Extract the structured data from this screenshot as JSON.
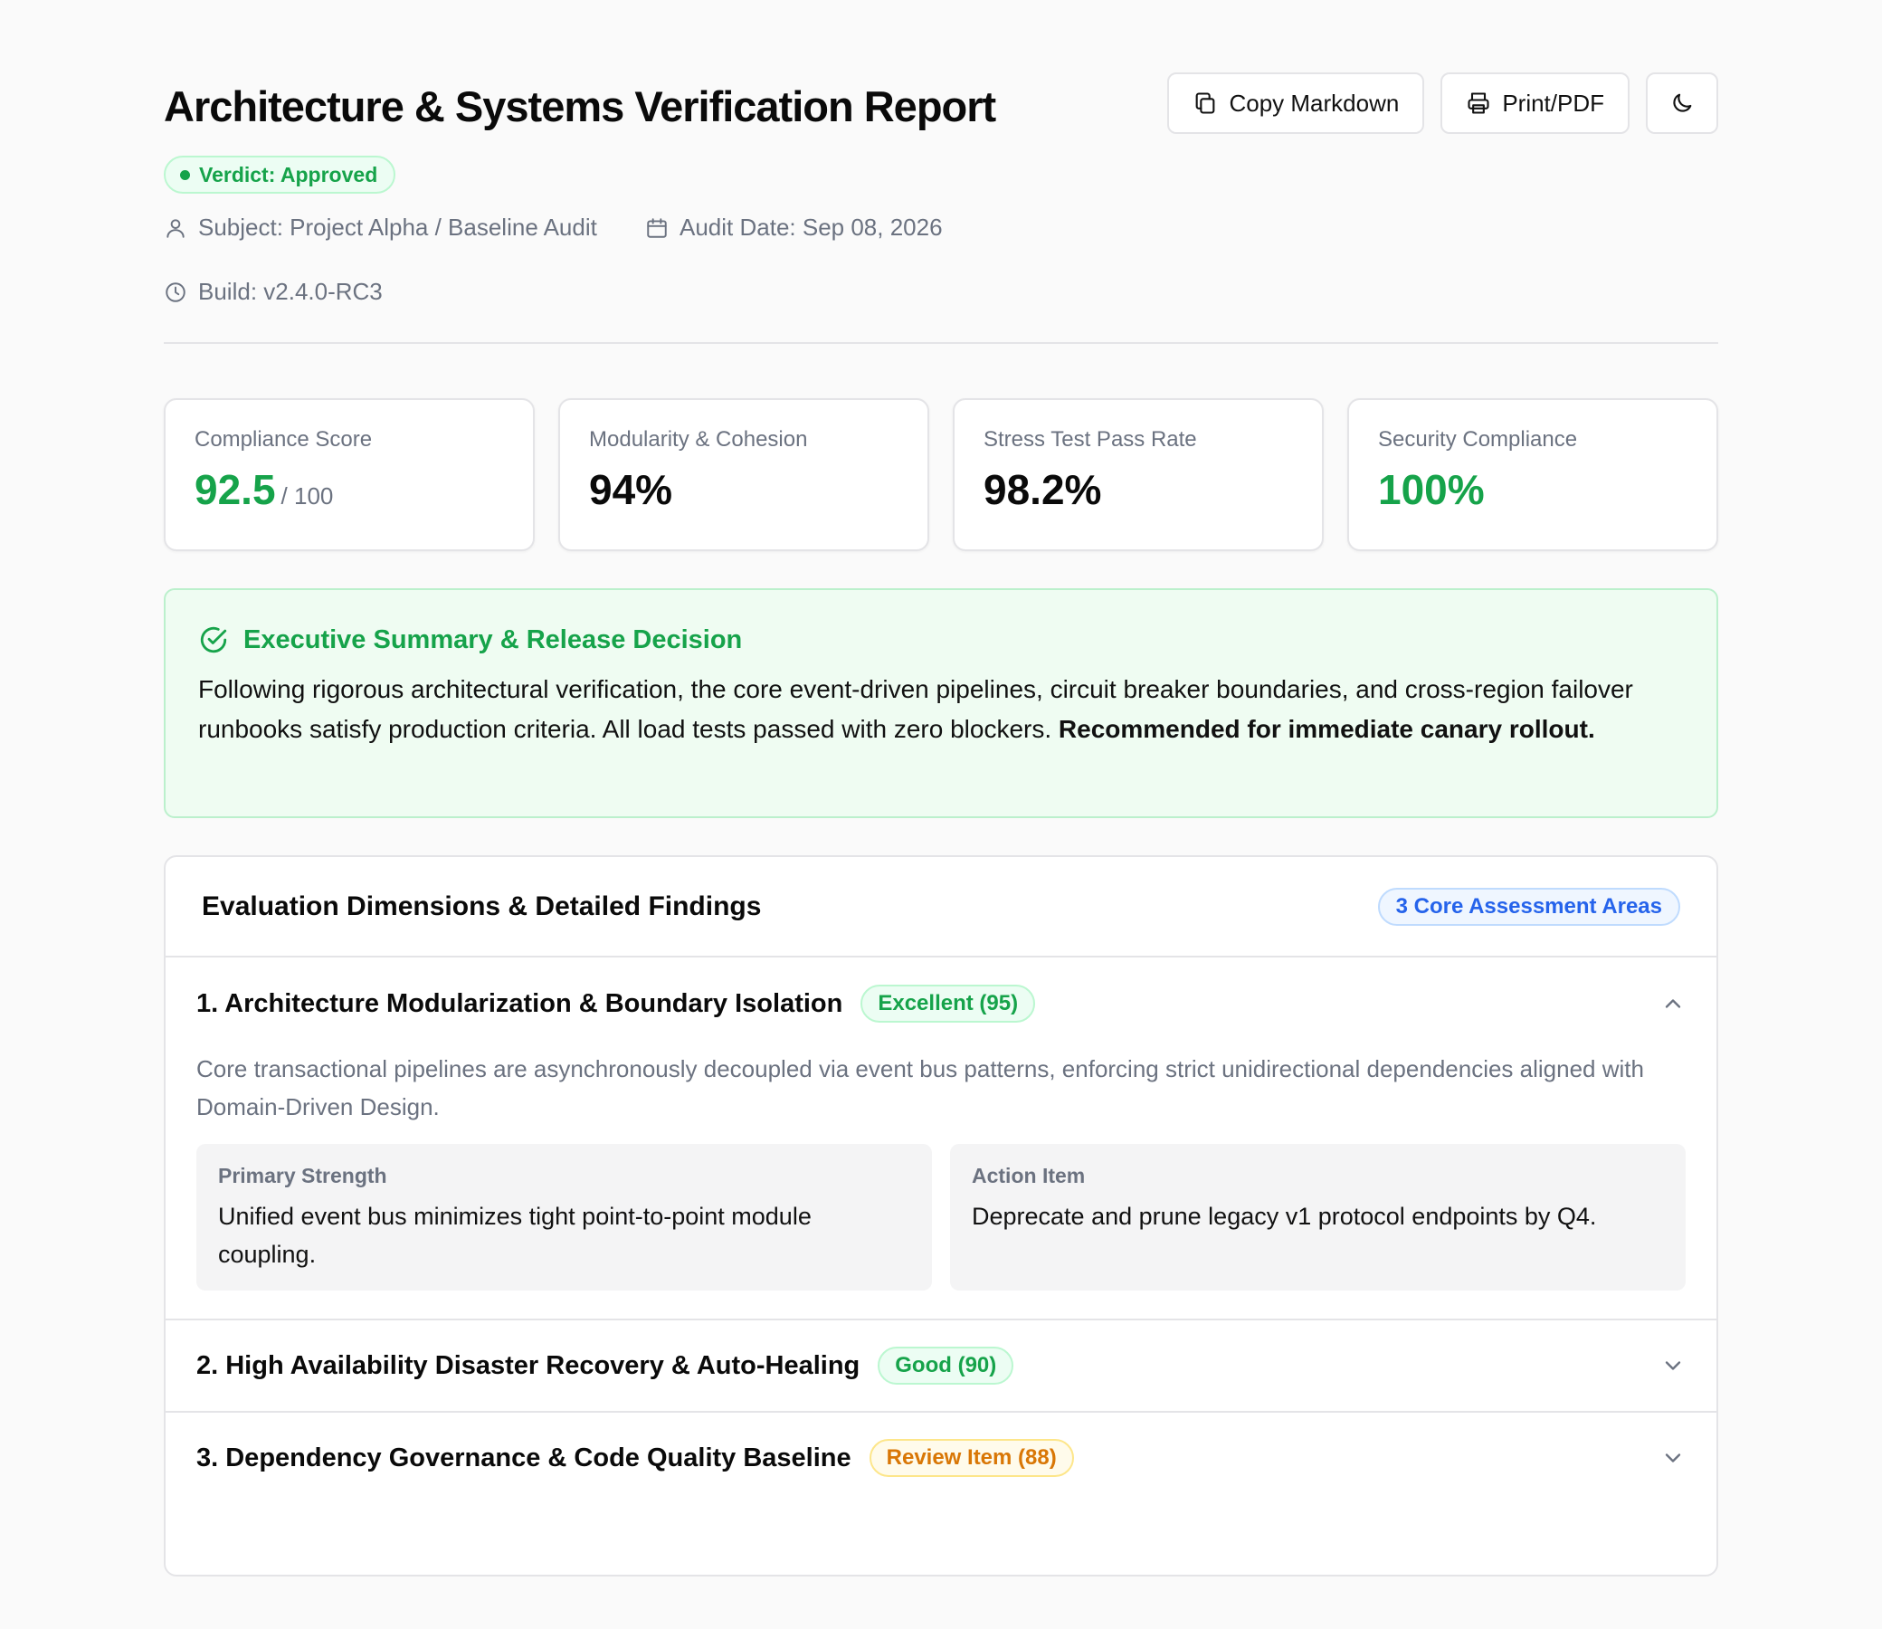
{
  "header": {
    "title": "Architecture & Systems Verification Report",
    "verdict": "Verdict: Approved",
    "subject": "Subject: Project Alpha / Baseline Audit",
    "audit_date": "Audit Date: Sep 08, 2026",
    "build": "Build: v2.4.0-RC3"
  },
  "actions": {
    "copy_markdown": "Copy Markdown",
    "print_pdf": "Print/PDF",
    "theme_icon": "moon-icon"
  },
  "stats": [
    {
      "label": "Compliance Score",
      "value": "92.5",
      "suffix": "/ 100"
    },
    {
      "label": "Modularity & Cohesion",
      "value": "94%"
    },
    {
      "label": "Stress Test Pass Rate",
      "value": "98.2%"
    },
    {
      "label": "Security Compliance",
      "value": "100%"
    }
  ],
  "summary": {
    "title": "Executive Summary & Release Decision",
    "text": "Following rigorous architectural verification, the core event-driven pipelines, circuit breaker boundaries, and cross-region failover runbooks satisfy production criteria. All load tests passed with zero blockers.",
    "emphasis": "Recommended for immediate canary rollout."
  },
  "findings": {
    "title": "Evaluation Dimensions & Detailed Findings",
    "badge": "3 Core Assessment Areas",
    "items": [
      {
        "title": "1. Architecture Modularization & Boundary Isolation",
        "rating": "Excellent (95)",
        "expanded": true,
        "description": "Core transactional pipelines are asynchronously decoupled via event bus patterns, enforcing strict unidirectional dependencies aligned with Domain-Driven Design.",
        "strength_label": "Primary Strength",
        "strength_text": "Unified event bus minimizes tight point-to-point module coupling.",
        "action_label": "Action Item",
        "action_text": "Deprecate and prune legacy v1 protocol endpoints by Q4."
      },
      {
        "title": "2. High Availability Disaster Recovery & Auto-Healing",
        "rating": "Good (90)",
        "expanded": false
      },
      {
        "title": "3. Dependency Governance & Code Quality Baseline",
        "rating": "Review Item (88)",
        "expanded": false
      }
    ]
  },
  "colors": {
    "accent_green": "#16a34a",
    "accent_blue": "#2563eb",
    "accent_amber": "#d97706",
    "summary_bg": "#effcf2"
  }
}
